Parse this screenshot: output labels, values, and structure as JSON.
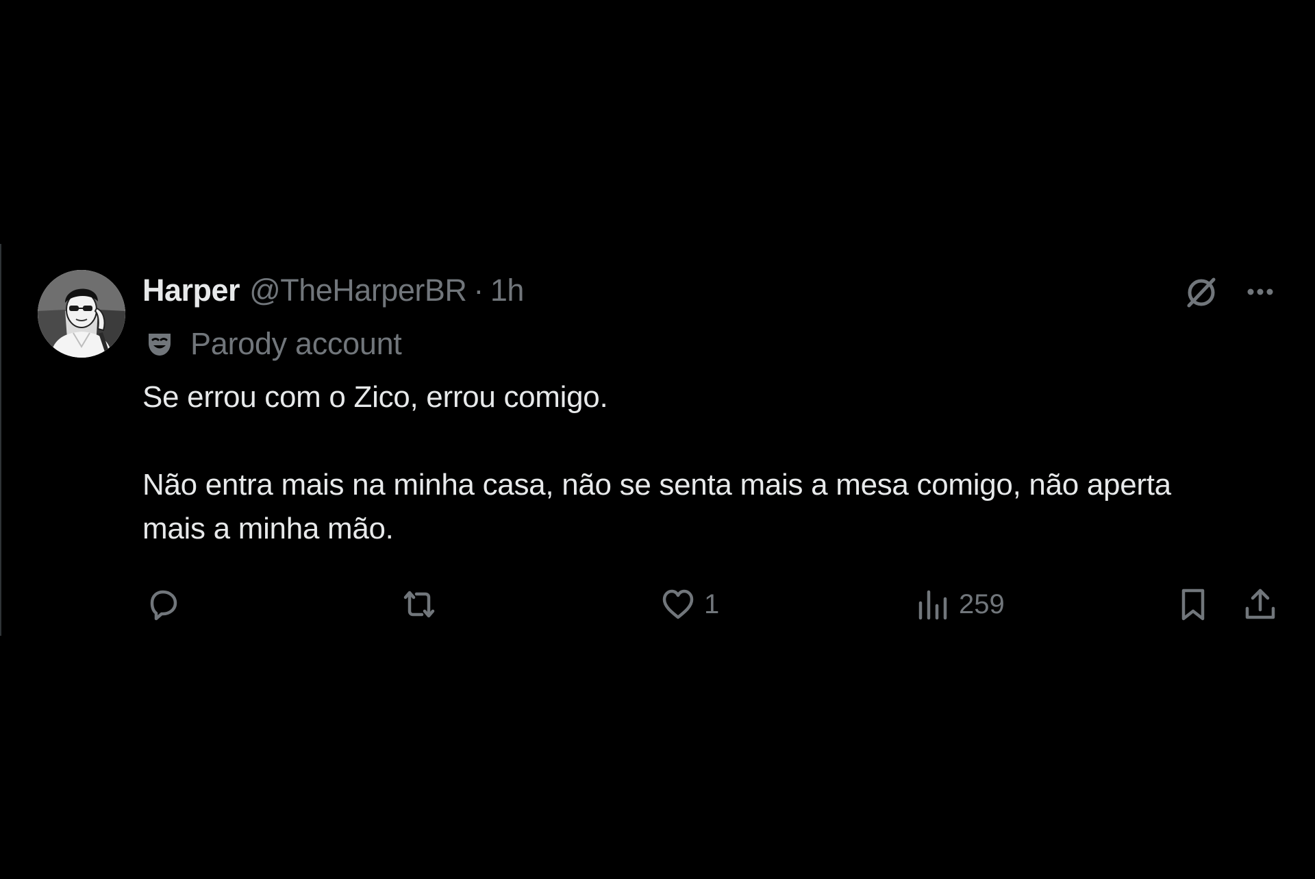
{
  "tweet": {
    "display_name": "Harper",
    "handle": "@TheHarperBR",
    "separator": "·",
    "time": "1h",
    "label": "Parody account",
    "text_paragraphs": [
      "Se errou com o Zico, errou comigo.",
      "Não entra mais na minha casa, não se senta mais a mesa comigo, não aperta mais a minha mão."
    ]
  },
  "actions": {
    "reply": {
      "icon": "reply-icon",
      "count": ""
    },
    "repost": {
      "icon": "repost-icon",
      "count": ""
    },
    "like": {
      "icon": "heart-icon",
      "count": "1"
    },
    "views": {
      "icon": "views-icon",
      "count": "259"
    },
    "bookmark": {
      "icon": "bookmark-icon"
    },
    "share": {
      "icon": "share-icon"
    }
  },
  "colors": {
    "background": "#000000",
    "primary_text": "#e7e9ea",
    "secondary_text": "#71767b",
    "divider": "#2f3336"
  }
}
